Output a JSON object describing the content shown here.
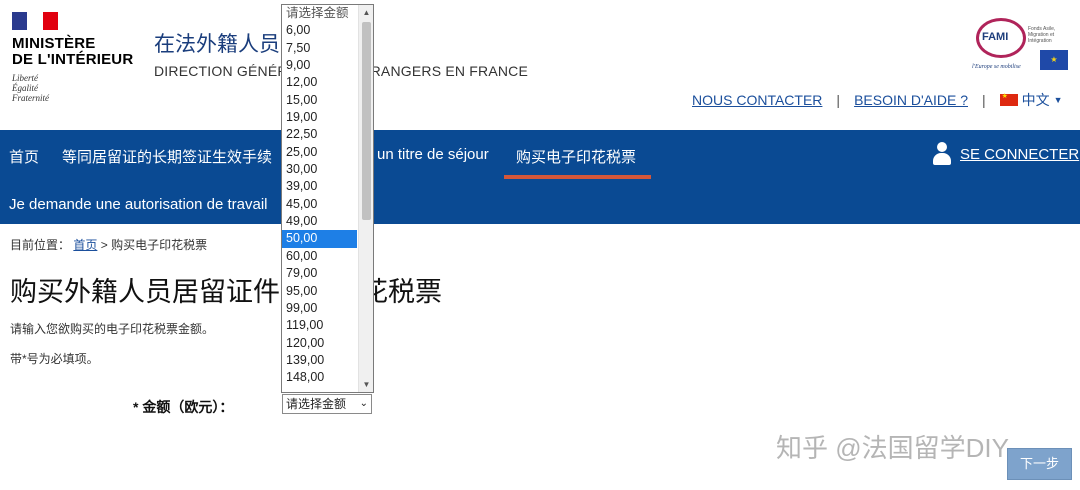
{
  "header": {
    "ministry_line1": "MINISTÈRE",
    "ministry_line2": "DE L'INTÉRIEUR",
    "motto": [
      "Liberté",
      "Égalité",
      "Fraternité"
    ],
    "site_title": "在法外籍人员",
    "site_subtitle": "DIRECTION GÉNÉRALE DES ÉTRANGERS EN FRANCE",
    "fami_name": "FAMI",
    "fami_small": "Fonds Asile, Migration et Intégration",
    "fami_tagline": "l'Europe se mobilise",
    "links": {
      "contact": "NOUS CONTACTER",
      "help": "BESOIN D'AIDE ?",
      "language": "中文",
      "separator": "|"
    }
  },
  "nav": {
    "items": [
      "首页",
      "等同居留证的长期签证生效手续",
      "un titre de séjour",
      "购买电子印花税票"
    ],
    "active": "购买电子印花税票",
    "row2": "Je demande une autorisation de travail",
    "connect": "SE CONNECTER"
  },
  "breadcrumb": {
    "prefix": "目前位置：",
    "home": "首页",
    "sep": ">",
    "current": "购买电子印花税票"
  },
  "main": {
    "title": "购买外籍人员居留证件电子印花税票",
    "description": "请输入您欲购买的电子印花税票金额。",
    "required_note": "带*号为必填项。",
    "amount_label": "* 金额（欧元）：",
    "select_value": "请选择金额",
    "next_button": "下一步"
  },
  "dropdown": {
    "options": [
      "请选择金额",
      "6,00",
      "7,50",
      "9,00",
      "12,00",
      "15,00",
      "19,00",
      "22,50",
      "25,00",
      "30,00",
      "39,00",
      "45,00",
      "49,00",
      "50,00",
      "60,00",
      "79,00",
      "95,00",
      "99,00",
      "119,00",
      "120,00",
      "139,00",
      "148,00"
    ],
    "selected": "50,00"
  },
  "watermark": "知乎 @法国留学DIY",
  "colors": {
    "nav_bg": "#0a4a93",
    "active_underline": "#d4573a",
    "link": "#1b4f9c",
    "selected_option": "#1e7fe6",
    "next_button": "#7ea3cc"
  }
}
